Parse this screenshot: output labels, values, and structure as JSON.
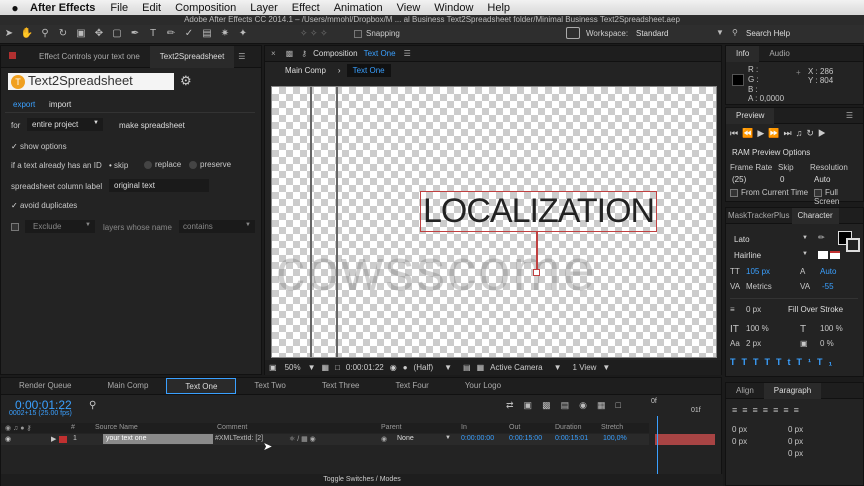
{
  "menu": {
    "apple": "",
    "app": "After Effects",
    "items": [
      "File",
      "Edit",
      "Composition",
      "Layer",
      "Effect",
      "Animation",
      "View",
      "Window",
      "Help"
    ]
  },
  "title": "Adobe After Effects CC 2014.1 – /Users/mmohl/Dropbox/M ... al Business Text2Spreadsheet folder/Minimal Business Text2Spreadsheet.aep",
  "toolbar": {
    "snapping": "Snapping",
    "workspace_label": "Workspace:",
    "workspace_value": "Standard",
    "search_help": "Search Help"
  },
  "left_panel": {
    "tab1": "Effect Controls your text one",
    "tab2": "Text2Spreadsheet",
    "logo": "Text2Spreadsheet",
    "tabs": [
      "export",
      "import"
    ],
    "for_label": "for",
    "for_value": "entire project",
    "make_button": "make spreadsheet",
    "show_options": "show options",
    "if_text_label": "if a text already has an ID",
    "skip": "skip",
    "replace": "replace",
    "preserve": "preserve",
    "column_label": "spreadsheet column label",
    "column_value": "original text",
    "avoid": "avoid duplicates",
    "exclude": "Exclude",
    "layers_whose_name": "layers whose name",
    "contains": "contains"
  },
  "comp_panel": {
    "header": "Composition",
    "header_name": "Text One",
    "tabs": [
      "Main Comp",
      "Text One"
    ],
    "canvas_text": "LOCALIZATION",
    "watermark": "Ccowsscome",
    "zoom": "50%",
    "timecode": "0:00:01:22",
    "quality": "(Half)",
    "camera": "Active Camera",
    "view": "1 View"
  },
  "info_panel": {
    "tab1": "Info",
    "tab2": "Audio",
    "r": "R :",
    "g": "G :",
    "b": "B :",
    "a": "A : 0,0000",
    "x": "X : 286",
    "y": "Y : 804"
  },
  "preview_panel": {
    "tab": "Preview",
    "ram": "RAM Preview Options",
    "frame_rate": "Frame Rate",
    "skip": "Skip",
    "resolution": "Resolution",
    "fr_value": "(25)",
    "skip_value": "0",
    "res_value": "Auto",
    "from_current": "From Current Time",
    "full_screen": "Full Screen"
  },
  "char_panel": {
    "tab1": "MaskTrackerPlus",
    "tab2": "Character",
    "font": "Lato",
    "style": "Hairline",
    "size": "105 px",
    "leading": "Auto",
    "kerning": "Metrics",
    "tracking": "-55",
    "stroke_w": "0 px",
    "stroke_type": "Fill Over Stroke",
    "vscale": "100 %",
    "hscale": "100 %",
    "baseline": "2 px",
    "tsume": "0 %"
  },
  "para_panel": {
    "tab1": "Align",
    "tab2": "Paragraph",
    "vals": [
      "0 px",
      "0 px",
      "0 px",
      "0 px",
      "0 px"
    ]
  },
  "timeline": {
    "tabs": [
      "Render Queue",
      "Main Comp",
      "Text One",
      "Text Two",
      "Text Three",
      "Text Four",
      "Your Logo"
    ],
    "timecode": "0:00:01:22",
    "fps": "0002+15 (25.00 fps)",
    "cols": [
      "#",
      "Source Name",
      "Comment",
      "Parent",
      "In",
      "Out",
      "Duration",
      "Stretch"
    ],
    "layer": {
      "num": "1",
      "name": "your text one",
      "comment": "#XMLTextId: [2]",
      "parent": "None",
      "in": "0:00:00:00",
      "out": "0:00:15:00",
      "duration": "0:00:15:01",
      "stretch": "100,0%"
    },
    "toggle": "Toggle Switches / Modes",
    "ruler": [
      "0f",
      "01f"
    ]
  },
  "colors": {
    "accent": "#3aa0ff",
    "logo": "#f0a020",
    "label_red": "#c03030"
  }
}
